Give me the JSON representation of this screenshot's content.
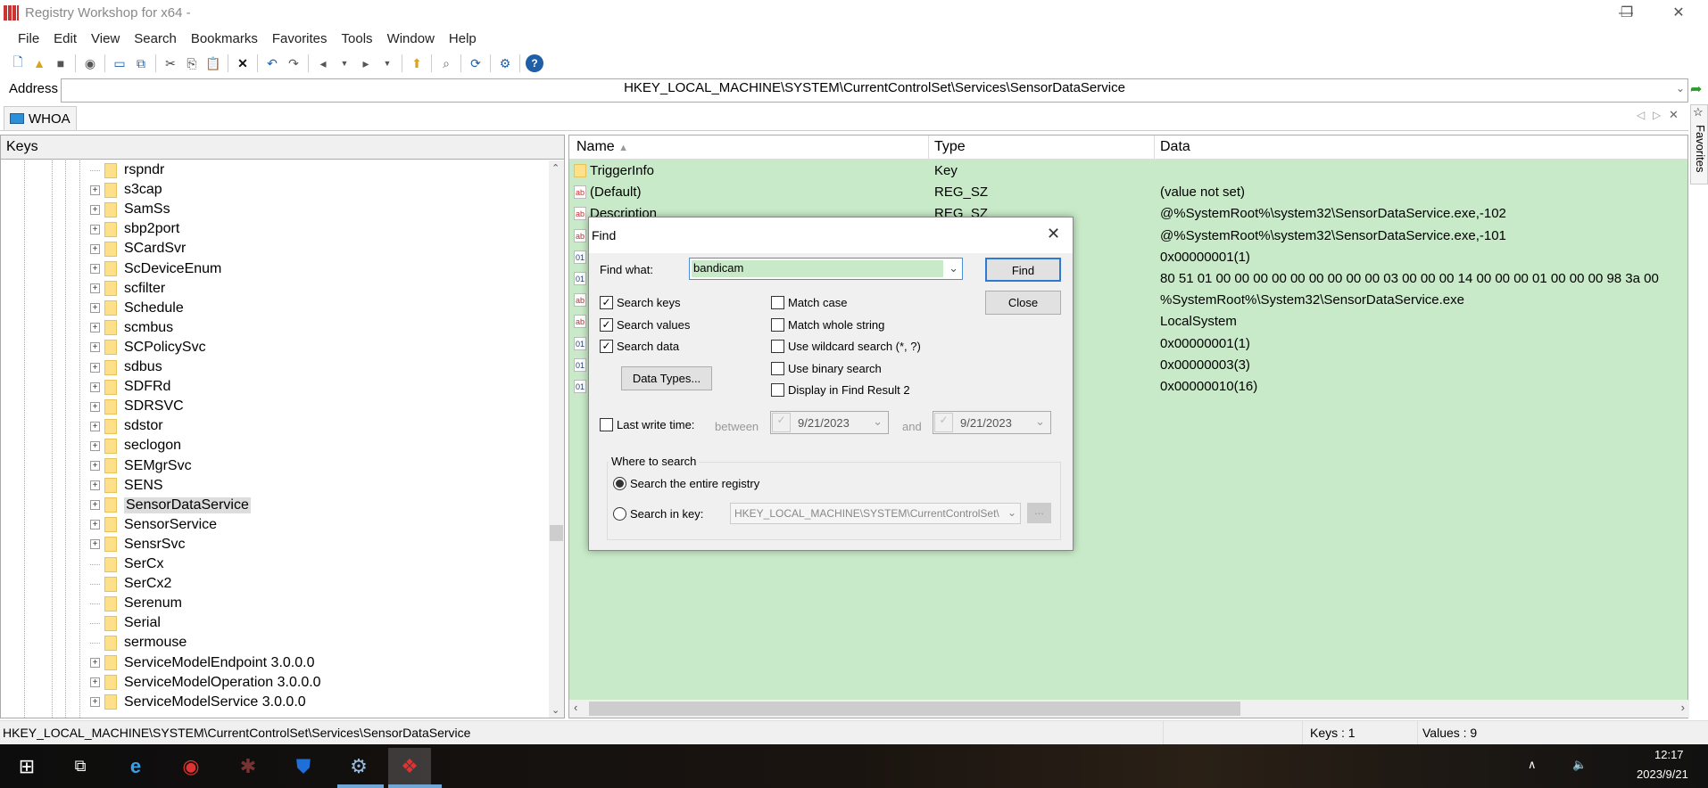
{
  "window": {
    "title": "Registry Workshop for x64 -",
    "min": "—",
    "max": "❐",
    "close": "✕"
  },
  "menu": [
    "File",
    "Edit",
    "View",
    "Search",
    "Bookmarks",
    "Favorites",
    "Tools",
    "Window",
    "Help"
  ],
  "address": {
    "label": "Address",
    "value": "HKEY_LOCAL_MACHINE\\SYSTEM\\CurrentControlSet\\Services\\SensorDataService"
  },
  "tab": {
    "label": "WHOA"
  },
  "favorites_tab": "Favorites",
  "tree": {
    "header": "Keys",
    "items": [
      {
        "label": "rspndr",
        "expand": false
      },
      {
        "label": "s3cap",
        "expand": true
      },
      {
        "label": "SamSs",
        "expand": true
      },
      {
        "label": "sbp2port",
        "expand": true
      },
      {
        "label": "SCardSvr",
        "expand": true
      },
      {
        "label": "ScDeviceEnum",
        "expand": true
      },
      {
        "label": "scfilter",
        "expand": true
      },
      {
        "label": "Schedule",
        "expand": true
      },
      {
        "label": "scmbus",
        "expand": true
      },
      {
        "label": "SCPolicySvc",
        "expand": true
      },
      {
        "label": "sdbus",
        "expand": true
      },
      {
        "label": "SDFRd",
        "expand": true
      },
      {
        "label": "SDRSVC",
        "expand": true
      },
      {
        "label": "sdstor",
        "expand": true
      },
      {
        "label": "seclogon",
        "expand": true
      },
      {
        "label": "SEMgrSvc",
        "expand": true
      },
      {
        "label": "SENS",
        "expand": true
      },
      {
        "label": "SensorDataService",
        "expand": true,
        "selected": true
      },
      {
        "label": "SensorService",
        "expand": true
      },
      {
        "label": "SensrSvc",
        "expand": true
      },
      {
        "label": "SerCx",
        "expand": false
      },
      {
        "label": "SerCx2",
        "expand": false
      },
      {
        "label": "Serenum",
        "expand": false
      },
      {
        "label": "Serial",
        "expand": false
      },
      {
        "label": "sermouse",
        "expand": false
      },
      {
        "label": "ServiceModelEndpoint 3.0.0.0",
        "expand": true
      },
      {
        "label": "ServiceModelOperation 3.0.0.0",
        "expand": true
      },
      {
        "label": "ServiceModelService 3.0.0.0",
        "expand": true
      }
    ]
  },
  "values": {
    "columns": [
      "Name",
      "Type",
      "Data"
    ],
    "rows": [
      {
        "icon": "key",
        "name": "TriggerInfo",
        "type": "Key",
        "data": ""
      },
      {
        "icon": "string",
        "name": "(Default)",
        "type": "REG_SZ",
        "data": "(value not set)"
      },
      {
        "icon": "string",
        "name": "Description",
        "type": "REG_SZ",
        "data": "@%SystemRoot%\\system32\\SensorDataService.exe,-102"
      },
      {
        "icon": "string",
        "name": "",
        "type": "",
        "data": "@%SystemRoot%\\system32\\SensorDataService.exe,-101"
      },
      {
        "icon": "binary",
        "name": "",
        "type": "",
        "data": "0x00000001(1)"
      },
      {
        "icon": "binary",
        "name": "",
        "type": "",
        "data": "80 51 01 00 00 00 00 00 00 00 00 00 03 00 00 00 14 00 00 00 01 00 00 00 98 3a 00"
      },
      {
        "icon": "string",
        "name": "",
        "type": "",
        "data": "%SystemRoot%\\System32\\SensorDataService.exe"
      },
      {
        "icon": "string",
        "name": "",
        "type": "",
        "data": "LocalSystem"
      },
      {
        "icon": "binary",
        "name": "",
        "type": "",
        "data": "0x00000001(1)"
      },
      {
        "icon": "binary",
        "name": "",
        "type": "",
        "data": "0x00000003(3)"
      },
      {
        "icon": "binary",
        "name": "",
        "type": "",
        "data": "0x00000010(16)"
      }
    ]
  },
  "status": {
    "path": "HKEY_LOCAL_MACHINE\\SYSTEM\\CurrentControlSet\\Services\\SensorDataService",
    "keys": "Keys : 1",
    "values": "Values : 9"
  },
  "taskbar": {
    "time": "12:17",
    "date": "2023/9/21"
  },
  "find": {
    "title": "Find",
    "close": "✕",
    "find_what_label": "Find what:",
    "find_what_value": "bandicam",
    "find_button": "Find",
    "close_button": "Close",
    "options_left": [
      {
        "label": "Search keys",
        "checked": true
      },
      {
        "label": "Search values",
        "checked": true
      },
      {
        "label": "Search data",
        "checked": true
      }
    ],
    "options_right": [
      {
        "label": "Match case",
        "checked": false
      },
      {
        "label": "Match whole string",
        "checked": false
      },
      {
        "label": "Use wildcard search (*, ?)",
        "checked": false
      },
      {
        "label": "Use binary search",
        "checked": false
      },
      {
        "label": "Display in Find Result 2",
        "checked": false
      }
    ],
    "data_types_button": "Data Types...",
    "last_write_label": "Last write time:",
    "between": "between",
    "and": "and",
    "date_from": "9/21/2023",
    "date_to": "9/21/2023",
    "where_label": "Where to search",
    "radio_entire": "Search the entire registry",
    "radio_key": "Search in key:",
    "key_value": "HKEY_LOCAL_MACHINE\\SYSTEM\\CurrentControlSet\\",
    "browse_button": "...",
    "accent": "#c8eac8"
  }
}
